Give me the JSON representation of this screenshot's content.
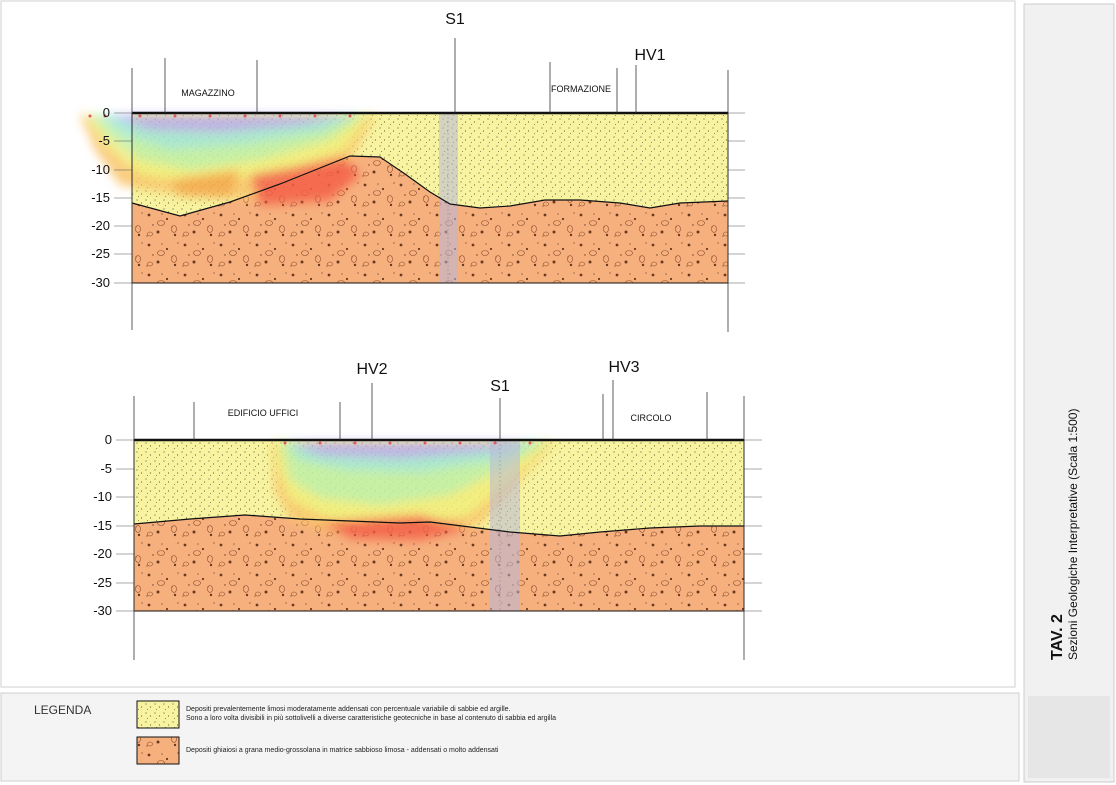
{
  "sections": [
    {
      "id": "section-1",
      "depth_labels": [
        "0",
        "-5",
        "-10",
        "-15",
        "-20",
        "-25",
        "-30"
      ],
      "profile_labels": [
        {
          "label": "S1"
        },
        {
          "label": "HV1"
        }
      ],
      "site_labels": [
        {
          "label": "MAGAZZINO"
        },
        {
          "label": "FORMAZIONE"
        }
      ]
    },
    {
      "id": "section-2",
      "depth_labels": [
        "0",
        "-5",
        "-10",
        "-15",
        "-20",
        "-25",
        "-30"
      ],
      "profile_labels": [
        {
          "label": "HV2"
        },
        {
          "label": "S1"
        },
        {
          "label": "HV3"
        }
      ],
      "site_labels": [
        {
          "label": "EDIFICIO UFFICI"
        },
        {
          "label": "CIRCOLO"
        }
      ]
    }
  ],
  "legend": {
    "title": "LEGENDA",
    "items": [
      {
        "name": "silty-deposits",
        "swatch_color": "#f7f3a0",
        "lines": [
          "Depositi prevalentemente limosi moderatamente addensati con percentuale variabile di sabbie ed argille.",
          "Sono a loro volta divisibili in più sottolivelli a diverse caratteristiche geotecniche in base al contenuto di sabbia ed argilla"
        ]
      },
      {
        "name": "gravel-deposits",
        "swatch_color": "#f6b07e",
        "lines": [
          "Depositi ghiaiosi  a grana medio-grossolana in matrice sabbioso limosa - addensati o molto addensati"
        ]
      }
    ]
  },
  "title_block": {
    "number": "TAV. 2",
    "subtitle": "Sezioni Geologiche Interpretative (Scala 1:500)"
  },
  "colors": {
    "silt": "#f7f3a0",
    "gravel": "#f6b07e",
    "outline": "#111111"
  }
}
